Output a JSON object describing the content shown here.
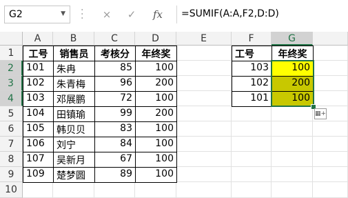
{
  "formula_bar": {
    "name_box": "G2",
    "cancel_icon": "×",
    "enter_icon": "✓",
    "fx_label": "fx",
    "formula": "=SUMIF(A:A,F2,D:D)"
  },
  "columns": [
    "A",
    "B",
    "C",
    "D",
    "E",
    "F",
    "G"
  ],
  "rows": [
    "1",
    "2",
    "3",
    "4",
    "5",
    "6",
    "7",
    "8",
    "9",
    "10"
  ],
  "table1": {
    "headers": [
      "工号",
      "销售员",
      "考核分",
      "年终奖"
    ],
    "rows": [
      [
        "101",
        "朱冉",
        "85",
        "100"
      ],
      [
        "102",
        "朱青梅",
        "96",
        "200"
      ],
      [
        "103",
        "邓展鹏",
        "72",
        "100"
      ],
      [
        "104",
        "田镇瑜",
        "99",
        "200"
      ],
      [
        "105",
        "韩贝贝",
        "83",
        "100"
      ],
      [
        "106",
        "刘宁",
        "84",
        "100"
      ],
      [
        "107",
        "吴新月",
        "67",
        "100"
      ],
      [
        "109",
        "楚梦圆",
        "89",
        "100"
      ]
    ]
  },
  "table2": {
    "headers": [
      "工号",
      "年终奖"
    ],
    "rows": [
      [
        "103",
        "100"
      ],
      [
        "102",
        "200"
      ],
      [
        "101",
        "100"
      ]
    ]
  },
  "colors": {
    "accent": "#217346",
    "highlight_yellow": "#ffff00",
    "highlight_olive": "#c8c800"
  }
}
